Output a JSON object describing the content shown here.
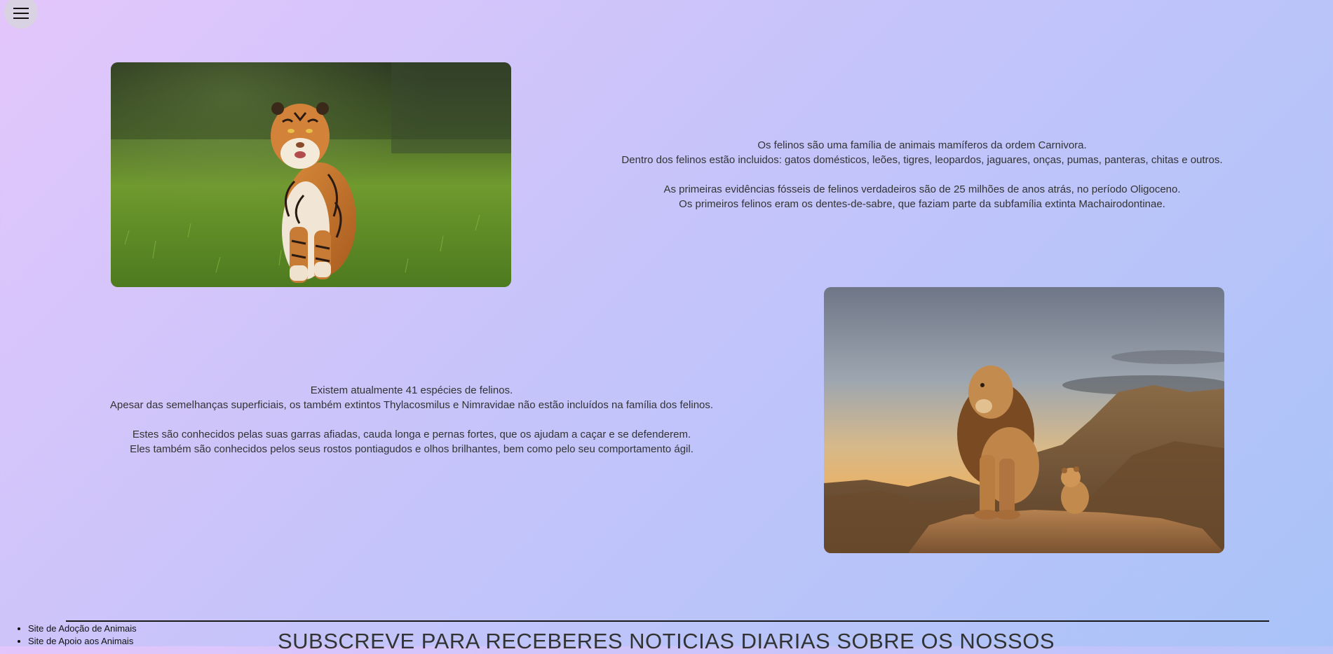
{
  "menu": {
    "icon": "hamburger-menu-icon"
  },
  "sections": [
    {
      "image_alt": "tiger",
      "paragraphs": [
        [
          "Os felinos são uma família de animais mamíferos da ordem Carnivora.",
          "Dentro dos felinos estão incluidos: gatos domésticos, leões, tigres, leopardos, jaguares, onças, pumas, panteras, chitas e outros."
        ],
        [
          "As primeiras evidências fósseis de felinos verdadeiros são de 25 milhões de anos atrás, no período Oligoceno.",
          "Os primeiros felinos eram os dentes-de-sabre, que faziam parte da subfamília extinta Machairodontinae."
        ]
      ]
    },
    {
      "image_alt": "lion",
      "paragraphs": [
        [
          "Existem atualmente 41 espécies de felinos.",
          "Apesar das semelhanças superficiais, os também extintos Thylacosmilus e Nimravidae não estão incluídos na família dos felinos."
        ],
        [
          "Estes são conhecidos pelas suas garras afiadas, cauda longa e pernas fortes, que os ajudam a caçar e se defenderem.",
          "Eles também são conhecidos pelos seus rostos pontiagudos e olhos brilhantes, bem como pelo seu comportamento ágil."
        ]
      ]
    }
  ],
  "footer": {
    "links": [
      "Site de Adoção de Animais",
      "Site de Apoio aos Animais"
    ],
    "subscribe_heading": "SUBSCREVE PARA RECEBERES NOTICIAS DIARIAS SOBRE OS NOSSOS"
  },
  "colors": {
    "background_start": "#e3c6fb",
    "background_end": "#a9c3f8",
    "text": "#333333"
  }
}
